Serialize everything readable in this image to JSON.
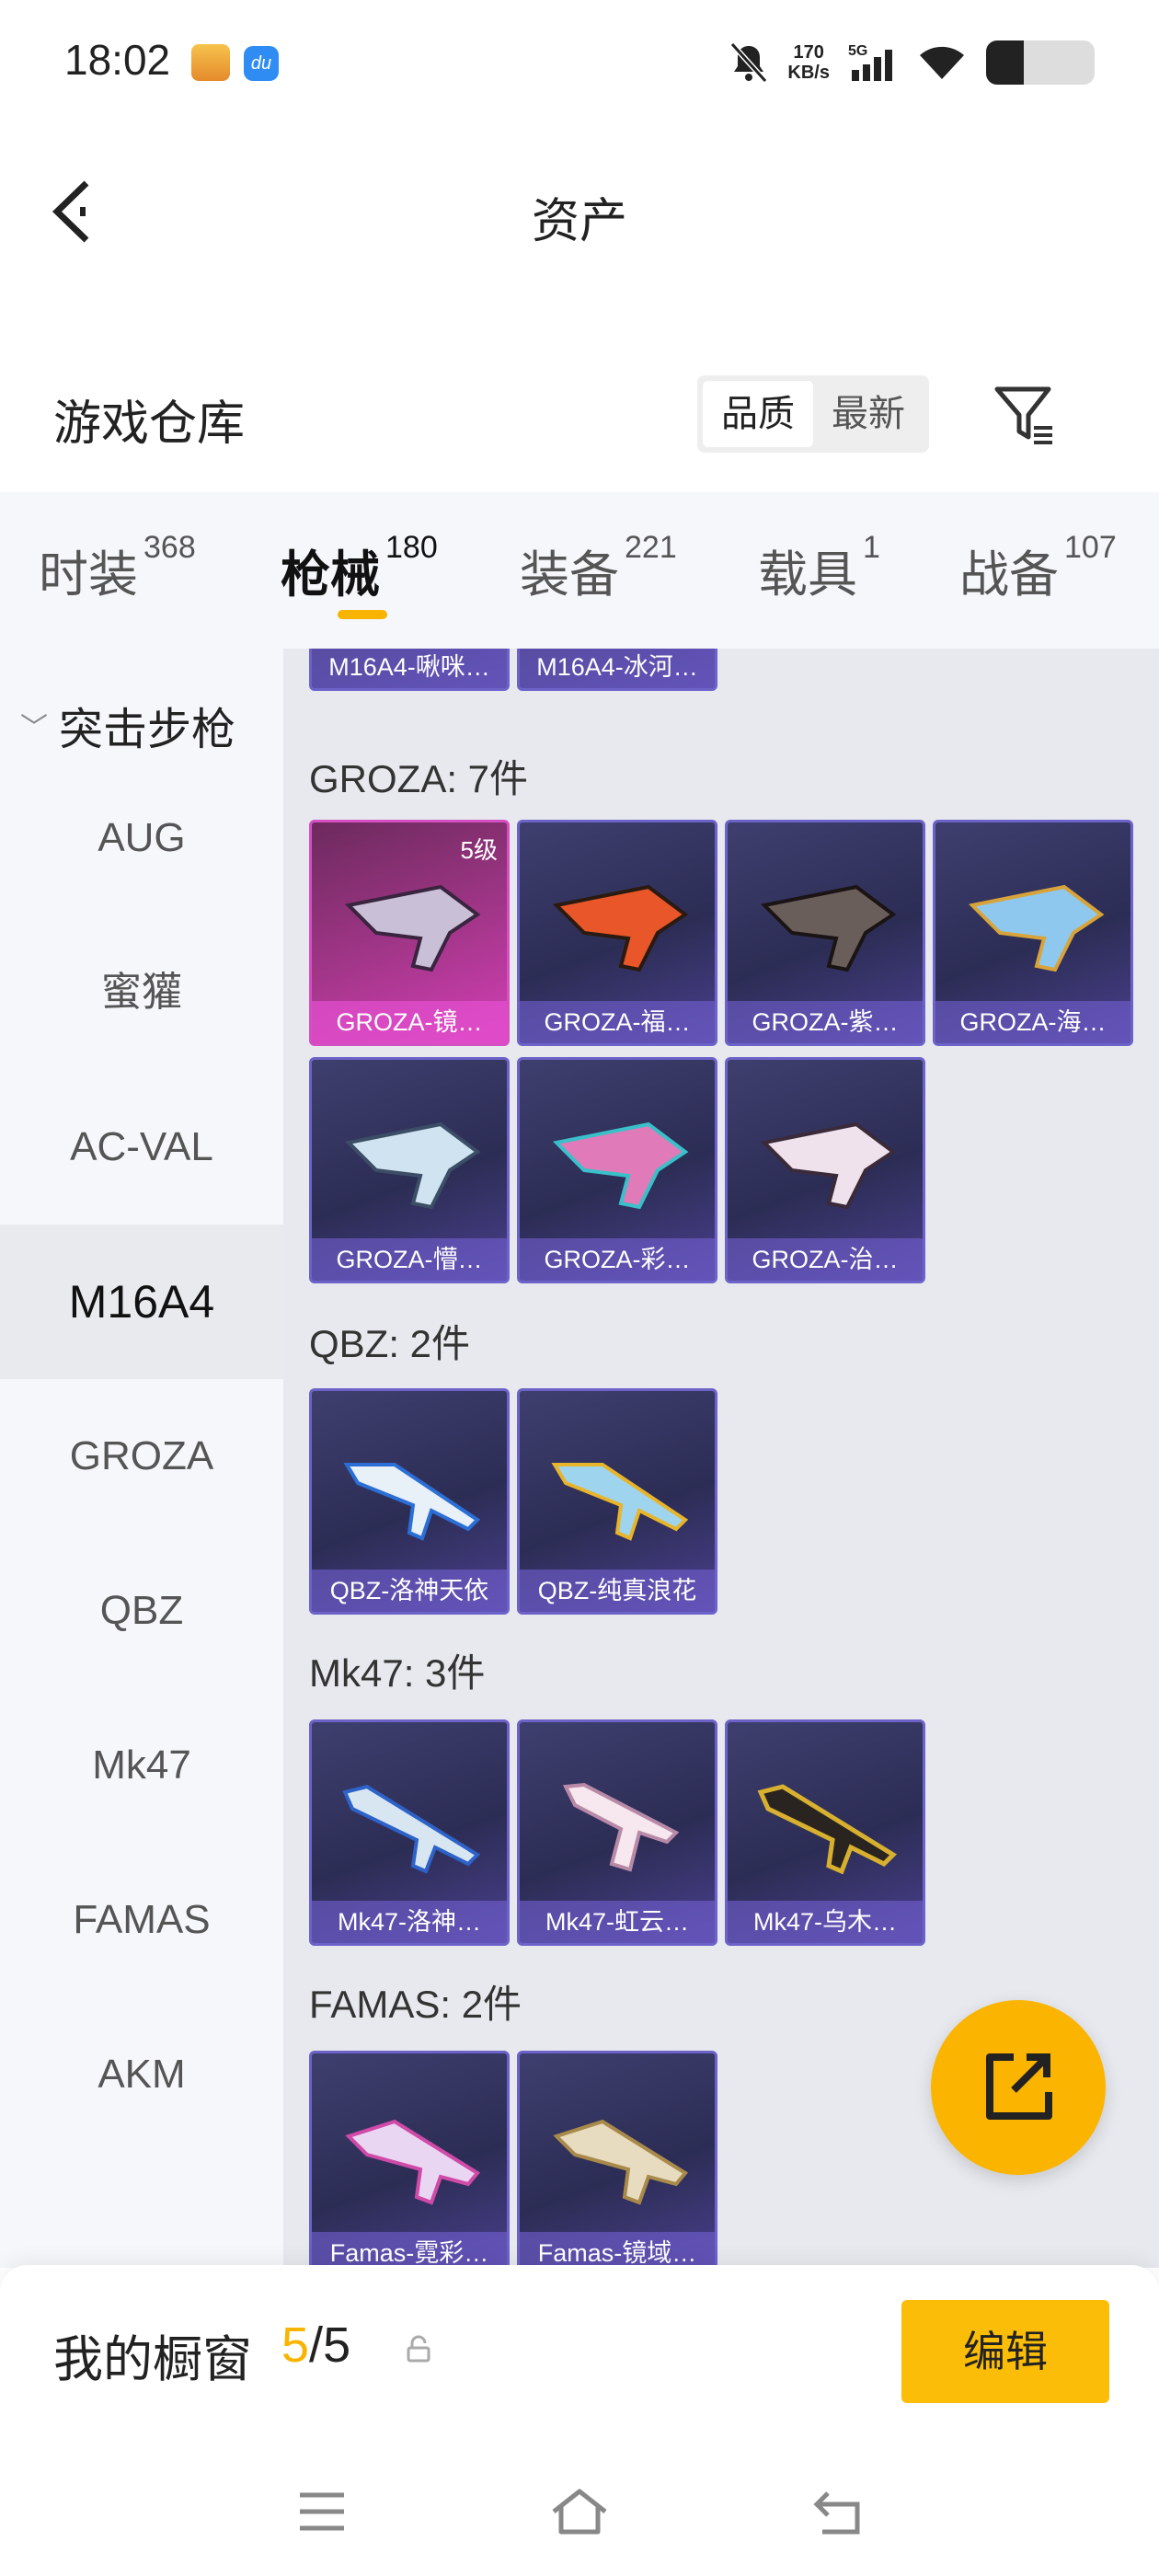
{
  "status_bar": {
    "time": "18:02",
    "speed_value": "170",
    "speed_unit": "KB/s",
    "network": "5G",
    "battery_level": 0.35,
    "app_badge_2": "du"
  },
  "header": {
    "title": "资产"
  },
  "warehouse": {
    "title": "游戏仓库",
    "sort_options": [
      "品质",
      "最新"
    ],
    "active_sort": "品质"
  },
  "tabs": [
    {
      "label": "时装",
      "count": "368"
    },
    {
      "label": "枪械",
      "count": "180"
    },
    {
      "label": "装备",
      "count": "221"
    },
    {
      "label": "载具",
      "count": "1"
    },
    {
      "label": "战备",
      "count": "107"
    }
  ],
  "active_tab": "枪械",
  "sidebar": {
    "category": "突击步枪",
    "items": [
      "AUG",
      "蜜獾",
      "AC-VAL",
      "M16A4",
      "GROZA",
      "QBZ",
      "Mk47",
      "FAMAS",
      "AKM"
    ],
    "active_item": "M16A4"
  },
  "content": {
    "top_partial_cards": [
      "M16A4-啾咪…",
      "M16A4-冰河…"
    ],
    "sections": [
      {
        "title": "GROZA: 7件",
        "items": [
          {
            "name": "GROZA-镜…",
            "level": "5级",
            "quality": "gold"
          },
          {
            "name": "GROZA-福…",
            "quality": "purple"
          },
          {
            "name": "GROZA-紫…",
            "quality": "purple"
          },
          {
            "name": "GROZA-海…",
            "quality": "purple"
          },
          {
            "name": "GROZA-懵…",
            "quality": "purple"
          },
          {
            "name": "GROZA-彩…",
            "quality": "purple"
          },
          {
            "name": "GROZA-治…",
            "quality": "purple"
          }
        ]
      },
      {
        "title": "QBZ: 2件",
        "items": [
          {
            "name": "QBZ-洛神天依",
            "quality": "purple"
          },
          {
            "name": "QBZ-纯真浪花",
            "quality": "purple"
          }
        ]
      },
      {
        "title": "Mk47: 3件",
        "items": [
          {
            "name": "Mk47-洛神…",
            "quality": "purple"
          },
          {
            "name": "Mk47-虹云…",
            "quality": "purple"
          },
          {
            "name": "Mk47-乌木…",
            "quality": "purple"
          }
        ]
      },
      {
        "title": "FAMAS: 2件",
        "items": [
          {
            "name": "Famas-霓彩…",
            "quality": "purple"
          },
          {
            "name": "Famas-镜域…",
            "quality": "purple"
          }
        ]
      }
    ]
  },
  "showcase": {
    "label": "我的橱窗",
    "current": "5",
    "separator": "/",
    "max": "5",
    "edit_label": "编辑"
  },
  "colors": {
    "accent": "#f8b400",
    "card_purple": "#2c2d55",
    "card_gold": "#a4368a"
  },
  "icons": [
    "back-arrow-icon",
    "filter-icon",
    "share-icon",
    "lock-icon",
    "menu-icon",
    "home-icon",
    "back-icon"
  ]
}
